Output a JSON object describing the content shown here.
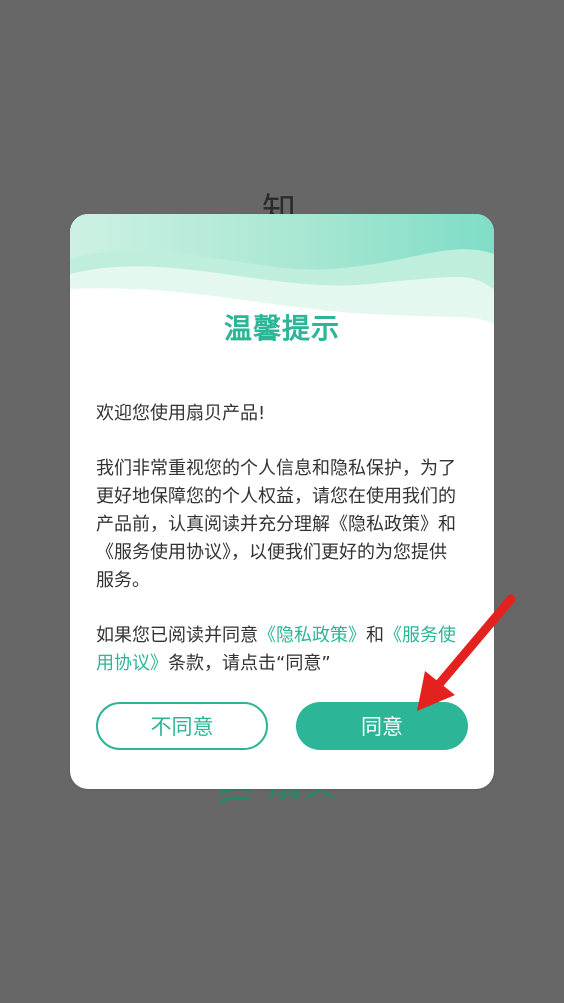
{
  "background": {
    "top_char": "知",
    "logo_name": "扇贝"
  },
  "dialog": {
    "title": "温馨提示",
    "welcome": "欢迎您使用扇贝产品!",
    "body_text": "我们非常重视您的个人信息和隐私保护，为了更好地保障您的个人权益，请您在使用我们的产品前，认真阅读并充分理解《隐私政策》和《服务使用协议》，以便我们更好的为您提供服务。",
    "consent": {
      "prefix": "如果您已阅读并同意",
      "privacy_link": "《隐私政策》",
      "and": "和",
      "service_link": "《服务使用协议》",
      "suffix": "条款，请点击“同意”"
    },
    "buttons": {
      "disagree": "不同意",
      "agree": "同意"
    }
  },
  "colors": {
    "accent": "#2cb596",
    "overlay": "#666666",
    "arrow": "#e3221f"
  }
}
